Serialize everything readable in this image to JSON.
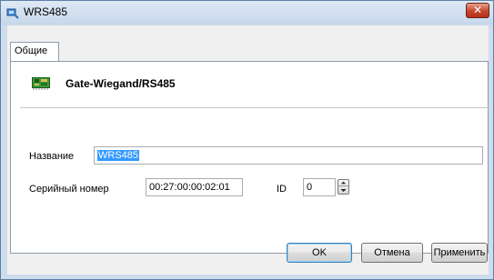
{
  "window": {
    "title": "WRS485",
    "close_glyph": "✕",
    "title_icon": "device-icon"
  },
  "tabs": [
    {
      "label": "Общие",
      "selected": true
    }
  ],
  "device": {
    "icon": "board-icon",
    "name": "Gate-Wiegand/RS485"
  },
  "form": {
    "name_label": "Название",
    "name_value": "WRS485",
    "serial_label": "Серийный номер",
    "serial_value": "00:27:00:00:02:01",
    "id_label": "ID",
    "id_value": "0"
  },
  "buttons": {
    "ok": "OK",
    "cancel": "Отмена",
    "apply": "Применить"
  },
  "colors": {
    "selection": "#3399ff",
    "close_button": "#c4452c",
    "frame": "#cfdcec"
  }
}
